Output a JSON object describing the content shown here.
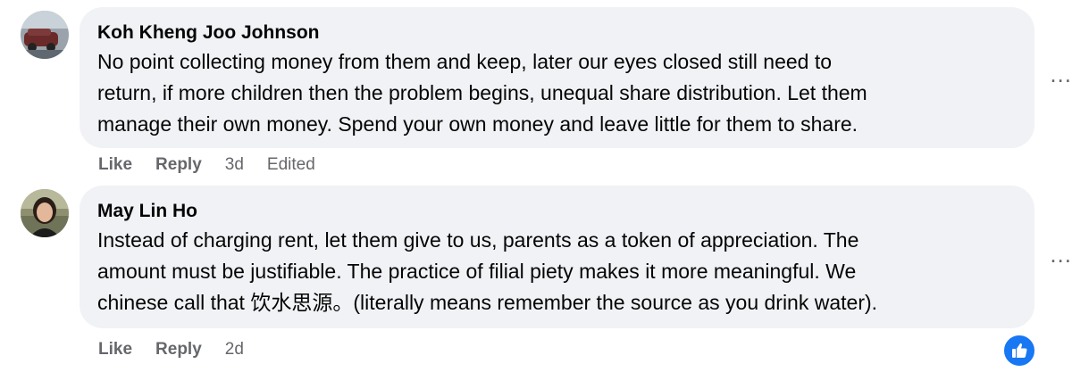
{
  "comments": [
    {
      "author": "Koh Kheng Joo Johnson",
      "lines": [
        "No point collecting money from them and keep, later our eyes closed still need to",
        "return, if more children then the problem begins, unequal share distribution. Let them",
        "manage their own money. Spend your own money and leave little for them to share."
      ],
      "like_label": "Like",
      "reply_label": "Reply",
      "time": "3d",
      "edited": "Edited",
      "more_label": "..."
    },
    {
      "author": "May Lin Ho",
      "lines": [
        "Instead of charging rent, let them give to us, parents as a token of appreciation. The",
        "amount must be justifiable. The practice of filial piety makes it more meaningful. We",
        "chinese call that 饮水思源。(literally means remember the source as you drink water)."
      ],
      "like_label": "Like",
      "reply_label": "Reply",
      "time": "2d",
      "more_label": "..."
    }
  ],
  "reaction": {
    "icon": "thumbs-up-icon",
    "color": "#1877f2"
  }
}
